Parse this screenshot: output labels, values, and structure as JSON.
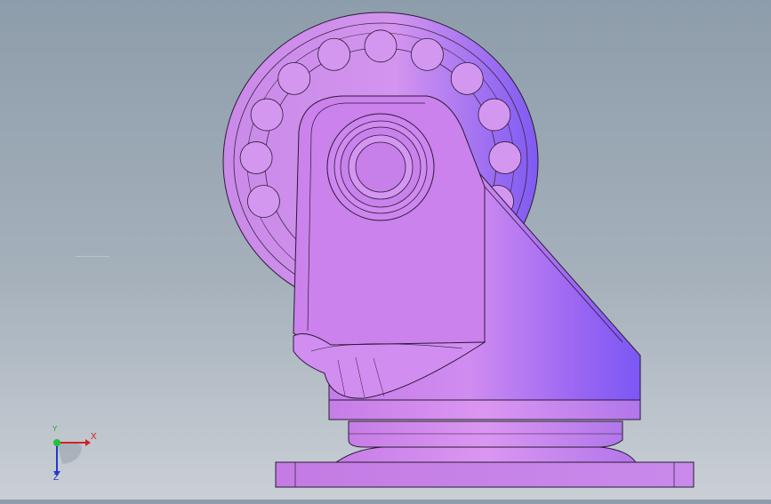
{
  "triad": {
    "x_label": "X",
    "y_label": "Y",
    "z_label": "Z"
  },
  "colors": {
    "part_light": "#d995ee",
    "part_mid": "#c77de6",
    "part_dark": "#8a5cf0",
    "edge": "#2a1a35",
    "bg_top": "#8e9dab",
    "bg_bottom": "#c9cfd5"
  },
  "model": {
    "name": "caster-wheel-assembly",
    "wheel_ball_count": 11
  }
}
